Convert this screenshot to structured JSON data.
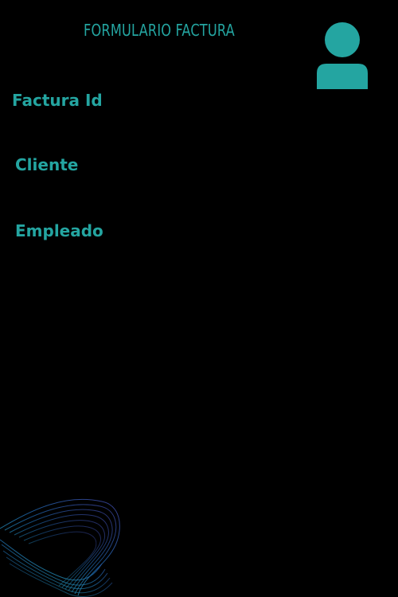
{
  "header": {
    "title": "Formulario Factura",
    "avatar_icon": "user-avatar-icon"
  },
  "form": {
    "labels": {
      "factura_id": "Factura Id",
      "cliente": "Cliente",
      "empleado": "Empleado"
    }
  },
  "decor": {
    "wave_icon": "mesh-wave-icon"
  },
  "colors": {
    "accent": "#24a5a1",
    "background": "#000000",
    "wave_teal": "#25a8a9",
    "wave_blue": "#1c5f9f",
    "wave_purple": "#3a3f95"
  }
}
